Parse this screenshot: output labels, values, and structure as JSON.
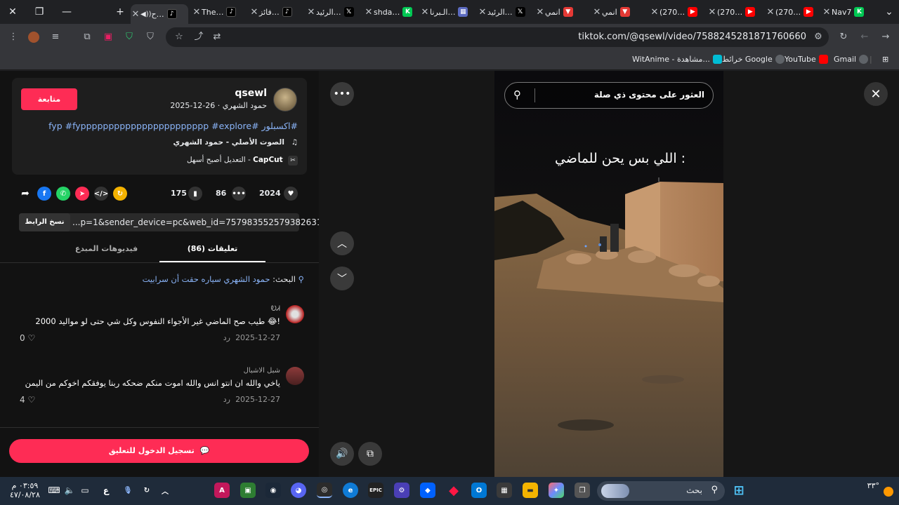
{
  "browser": {
    "tabs": [
      {
        "title": "Nav7",
        "favicon_color": "#00c853"
      },
      {
        "title": "(270…",
        "favicon_color": "#ff0000"
      },
      {
        "title": "(270…",
        "favicon_color": "#ff0000"
      },
      {
        "title": "(270…",
        "favicon_color": "#ff0000"
      },
      {
        "title": "انمي",
        "favicon_color": "#e53935"
      },
      {
        "title": "انمي",
        "favicon_color": "#e53935"
      },
      {
        "title": "الرئيد…",
        "favicon_color": "#000000"
      },
      {
        "title": "الـبرنا…",
        "favicon_color": "#5c6bc0"
      },
      {
        "title": "shda…",
        "favicon_color": "#00c853"
      },
      {
        "title": "الرئيد…",
        "favicon_color": "#000000"
      },
      {
        "title": "فائز…",
        "favicon_color": "#000000"
      },
      {
        "title": "The…",
        "favicon_color": "#000000"
      },
      {
        "title": "ح…",
        "favicon_color": "#000000"
      }
    ],
    "new_tab": "+",
    "url": "tiktok.com/@qsewl/video/7588245281871760660",
    "bookmarks": [
      {
        "label": "Gmail",
        "color": "#ea4335"
      },
      {
        "label": "YouTube",
        "color": "#ff0000"
      },
      {
        "label": "خرائط Google",
        "color": "#34a853"
      },
      {
        "label": "WitAnime - مشاهدة...",
        "color": "#00bcd4"
      }
    ]
  },
  "post": {
    "follow_label": "متابعة",
    "username": "qsewl",
    "display_name_date": "حمود الشهري · 26-12-2025",
    "hashtags": "#اكسبلور #fyp #fyppppppppppppppppppppppp #explore",
    "sound": "الصوت الأصلي - حمود الشهري",
    "capcut_brand": "CapCut",
    "capcut_text": "التعديل أصبح أسهل -",
    "likes": "2024",
    "comments_count": "86",
    "saves": "175",
    "link_text": "...p=1&sender_device=pc&web_id=7579835525793826311",
    "copy_link_label": "نسخ الرابط",
    "tab_comments": "تعليقات (86)",
    "tab_creator_videos": "فيديوهات المبدع",
    "search_prefix": "البحث:",
    "search_query": "حمود الشهري سياره حقت أن سرابيت",
    "comments": [
      {
        "name": "ᎧᏗ",
        "text": "طيب صح الماضي غير الأجواء النفوس وكل شي حتى لو مواليد 2000 😂!",
        "date": "2025-12-27",
        "reply": "رد",
        "likes": "0"
      },
      {
        "name": "شبل الاشبال",
        "text": "ياخي والله ان انتو انس والله اموت منكم ضحكه ربنا يوفقكم اخوكم من اليمن",
        "date": "2025-12-27",
        "reply": "رد",
        "likes": "4"
      }
    ],
    "login_comment_label": "تسجيل الدخول للتعليق"
  },
  "video": {
    "search_placeholder": "العثور على محتوى ذي صلة",
    "caption": "اللي بس يحن للماضي :"
  },
  "taskbar": {
    "search_label": "بحث",
    "time": "٠٣:٥٩ م",
    "date": "٤٧/٠٨/٢٨",
    "temperature": "٣٣°",
    "lang": "ع"
  }
}
